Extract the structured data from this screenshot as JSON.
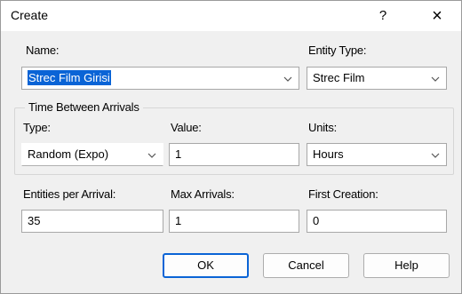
{
  "window": {
    "title": "Create",
    "help_icon": "?",
    "close_icon": "×"
  },
  "name": {
    "label": "Name:",
    "value": "Strec Film Girisi"
  },
  "entity_type": {
    "label": "Entity Type:",
    "value": "Strec Film"
  },
  "time_between_arrivals": {
    "group_title": "Time Between Arrivals",
    "type": {
      "label": "Type:",
      "value": "Random (Expo)"
    },
    "value": {
      "label": "Value:",
      "value": "1"
    },
    "units": {
      "label": "Units:",
      "value": "Hours"
    }
  },
  "entities_per_arrival": {
    "label": "Entities per Arrival:",
    "value": "35"
  },
  "max_arrivals": {
    "label": "Max Arrivals:",
    "value": "1"
  },
  "first_creation": {
    "label": "First Creation:",
    "value": "0"
  },
  "buttons": {
    "ok": "OK",
    "cancel": "Cancel",
    "help": "Help"
  }
}
